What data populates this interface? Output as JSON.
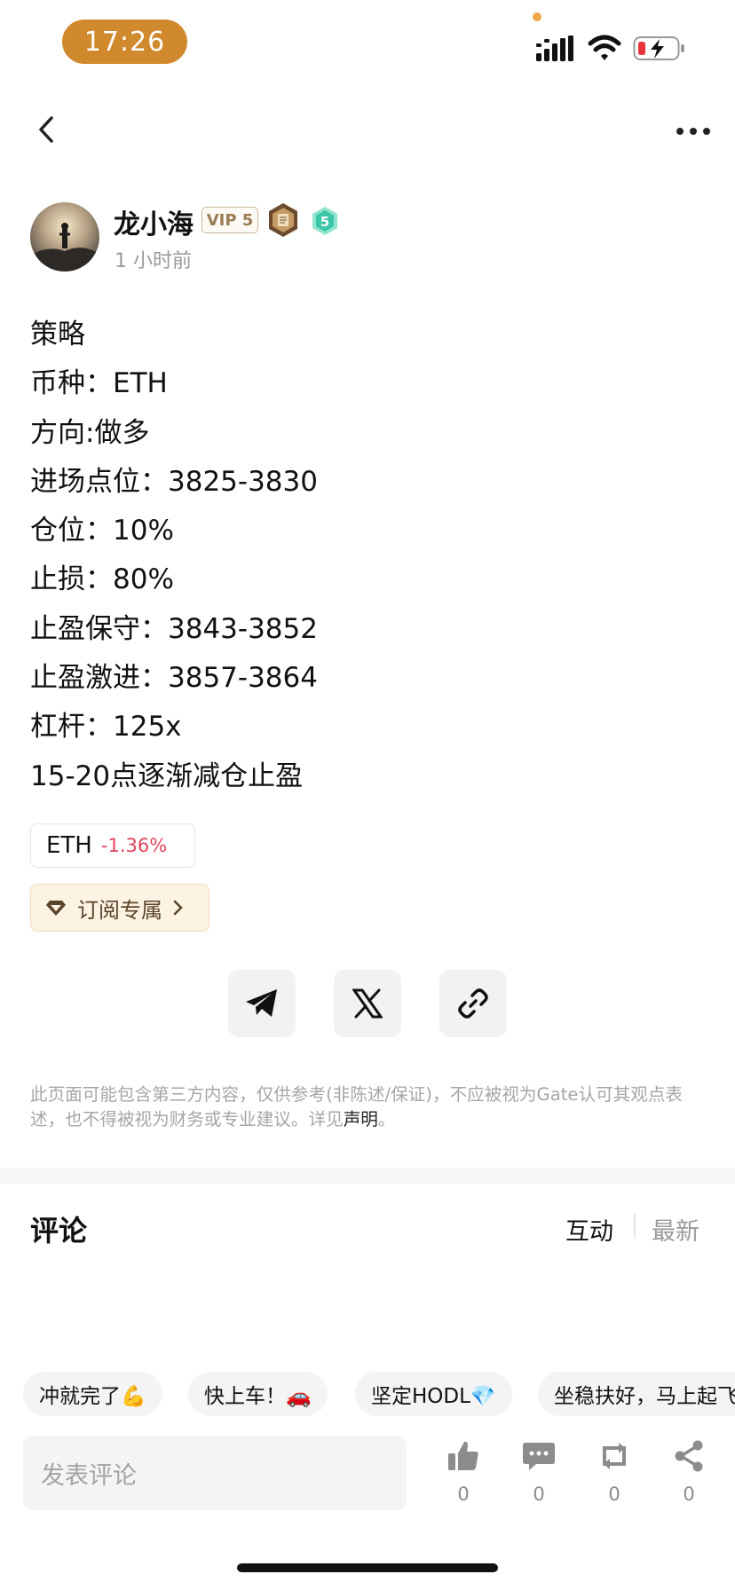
{
  "status_bar": {
    "time": "17:26",
    "icons": [
      "signal-icon",
      "wifi-icon",
      "battery-charging-icon"
    ]
  },
  "nav": {
    "icons": [
      "back-icon",
      "more-icon"
    ]
  },
  "author": {
    "name": "龙小海",
    "vip": "VIP 5",
    "level": "5",
    "time": "1 小时前",
    "icons": [
      "avatar",
      "medal-icon",
      "level-badge-icon"
    ]
  },
  "post": {
    "lines": [
      "策略",
      "币种：ETH",
      "方向:做多",
      "进场点位：3825-3830",
      "仓位：10%",
      "止损：80%",
      "止盈保守：3843-3852",
      "止盈激进：3857-3864",
      "杠杆：125x",
      "15-20点逐渐减仓止盈"
    ]
  },
  "coin_tag": {
    "symbol": "ETH",
    "change": "-1.36%",
    "change_color": "#e0455c"
  },
  "subscribe": {
    "label": "订阅专属",
    "icons": [
      "diamond-icon",
      "chevron-right-icon"
    ]
  },
  "share": {
    "icons": [
      "telegram-icon",
      "x-icon",
      "link-icon"
    ]
  },
  "disclaimer": {
    "text": "此页面可能包含第三方内容，仅供参考(非陈述/保证)，不应被视为Gate认可其观点表述，也不得被视为财务或专业建议。详见",
    "link": "声明",
    "end": "。"
  },
  "comments": {
    "title": "评论",
    "sort_hot": "互动",
    "sort_new": "最新"
  },
  "quick_replies": [
    "冲就完了💪",
    "快上车！🚗",
    "坚定HODL💎",
    "坐稳扶好，马上起飞"
  ],
  "bottom_bar": {
    "placeholder": "发表评论",
    "like_count": "0",
    "comment_count": "0",
    "repost_count": "0",
    "share_count": "0",
    "icons": [
      "thumbs-up-icon",
      "comment-icon",
      "repost-icon",
      "share-icon"
    ]
  },
  "colors": {
    "accent": "#d1892d",
    "negative": "#e0455c",
    "subscribe_bg": "#fdf3e3"
  }
}
